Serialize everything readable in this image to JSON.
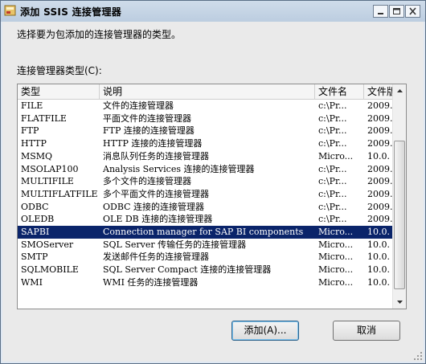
{
  "window": {
    "title": "添加 SSIS 连接管理器",
    "minimize_icon": "minimize-icon",
    "maximize_icon": "maximize-icon",
    "close_icon": "close-icon"
  },
  "instruction": "选择要为包添加的连接管理器的类型。",
  "list_label": "连接管理器类型(C):",
  "columns": [
    "类型",
    "说明",
    "文件名",
    "文件版本"
  ],
  "rows": [
    {
      "type": "FILE",
      "desc": "文件的连接管理器",
      "file": "c:\\Pr...",
      "ver": "2009."
    },
    {
      "type": "FLATFILE",
      "desc": "平面文件的连接管理器",
      "file": "c:\\Pr...",
      "ver": "2009."
    },
    {
      "type": "FTP",
      "desc": "FTP 连接的连接管理器",
      "file": "c:\\Pr...",
      "ver": "2009."
    },
    {
      "type": "HTTP",
      "desc": "HTTP 连接的连接管理器",
      "file": "c:\\Pr...",
      "ver": "2009."
    },
    {
      "type": "MSMQ",
      "desc": "消息队列任务的连接管理器",
      "file": "Micro...",
      "ver": "10.0."
    },
    {
      "type": "MSOLAP100",
      "desc": "Analysis Services 连接的连接管理器",
      "file": "c:\\Pr...",
      "ver": "2009."
    },
    {
      "type": "MULTIFILE",
      "desc": "多个文件的连接管理器",
      "file": "c:\\Pr...",
      "ver": "2009."
    },
    {
      "type": "MULTIFLATFILE",
      "desc": "多个平面文件的连接管理器",
      "file": "c:\\Pr...",
      "ver": "2009."
    },
    {
      "type": "ODBC",
      "desc": "ODBC 连接的连接管理器",
      "file": "c:\\Pr...",
      "ver": "2009."
    },
    {
      "type": "OLEDB",
      "desc": "OLE DB 连接的连接管理器",
      "file": "c:\\Pr...",
      "ver": "2009."
    },
    {
      "type": "SAPBI",
      "desc": "Connection manager for SAP BI components",
      "file": "Micro...",
      "ver": "10.0.",
      "selected": true
    },
    {
      "type": "SMOServer",
      "desc": "SQL Server 传输任务的连接管理器",
      "file": "Micro...",
      "ver": "10.0."
    },
    {
      "type": "SMTP",
      "desc": "发送邮件任务的连接管理器",
      "file": "Micro...",
      "ver": "10.0."
    },
    {
      "type": "SQLMOBILE",
      "desc": "SQL Server Compact 连接的连接管理器",
      "file": "Micro...",
      "ver": "10.0."
    },
    {
      "type": "WMI",
      "desc": "WMI 任务的连接管理器",
      "file": "Micro...",
      "ver": "10.0."
    }
  ],
  "buttons": {
    "add": "添加(A)...",
    "cancel": "取消"
  },
  "colors": {
    "selection": "#0a246a",
    "titlebar": "#c4d3e5"
  }
}
